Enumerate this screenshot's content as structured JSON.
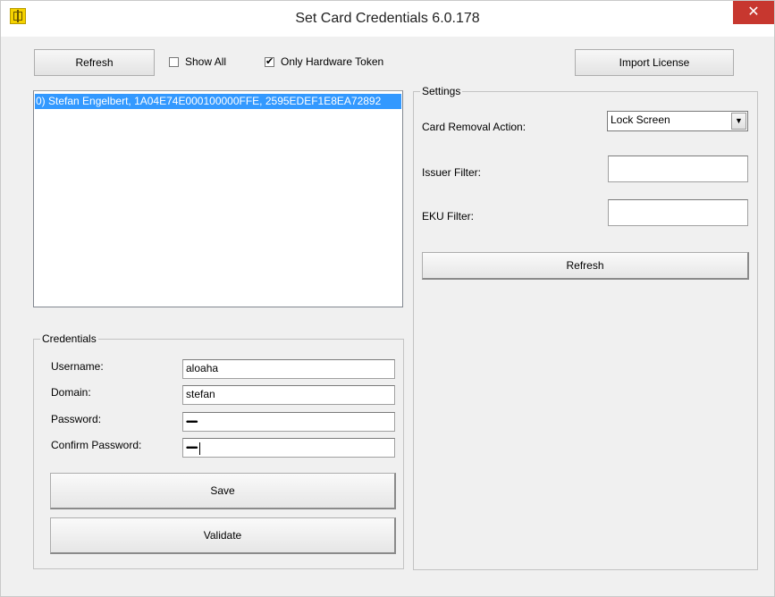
{
  "window": {
    "title": "Set Card Credentials 6.0.178",
    "close_label": "✕"
  },
  "toolbar": {
    "refresh_label": "Refresh",
    "show_all_label": "Show All",
    "show_all_checked": false,
    "only_hardware_token_label": "Only Hardware Token",
    "only_hardware_token_checked": true,
    "import_license_label": "Import License"
  },
  "certificate_list": {
    "items": [
      {
        "label": "0) Stefan Engelbert, 1A04E74E000100000FFE, 2595EDEF1E8EA72892",
        "selected": true
      }
    ]
  },
  "credentials": {
    "group_label": "Credentials",
    "username_label": "Username:",
    "username_value": "aloaha",
    "domain_label": "Domain:",
    "domain_value": "stefan",
    "password_label": "Password:",
    "password_value": "••••••••••",
    "confirm_password_label": "Confirm Password:",
    "confirm_password_value": "••••••••••",
    "save_label": "Save",
    "validate_label": "Validate"
  },
  "settings": {
    "group_label": "Settings",
    "card_removal_label": "Card Removal Action:",
    "card_removal_value": "Lock Screen",
    "issuer_filter_label": "Issuer Filter:",
    "issuer_filter_value": "",
    "eku_filter_label": "EKU Filter:",
    "eku_filter_value": "",
    "refresh_label": "Refresh"
  },
  "colors": {
    "selection": "#3399ff",
    "close_button": "#c7372f",
    "window_bg": "#f0f0f0"
  }
}
